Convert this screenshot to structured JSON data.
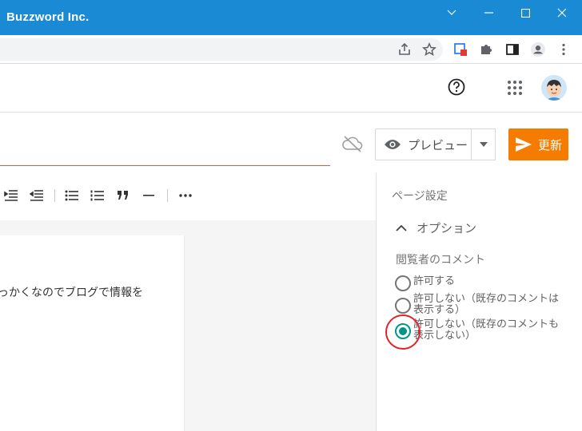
{
  "window": {
    "title": "Buzzword Inc."
  },
  "browser": {
    "icons": [
      "share-icon",
      "star-icon",
      "extension-badge-icon",
      "puzzle-icon",
      "sidepanel-icon",
      "profile-icon",
      "kebab-menu-icon"
    ]
  },
  "editor": {
    "preview_label": "プレビュー",
    "update_label": "更新",
    "body_text": "っかくなのでブログで情報を",
    "accent_color": "#f57c00",
    "title_underline_color": "#e8553f"
  },
  "sidebar": {
    "heading": "ページ設定",
    "section_label": "オプション",
    "comments_label": "閲覧者のコメント",
    "options": [
      {
        "label": "許可する",
        "selected": false
      },
      {
        "label": "許可しない（既存のコメントは表示する）",
        "selected": false
      },
      {
        "label": "許可しない（既存のコメントも表示しない）",
        "selected": true
      }
    ],
    "radio_color": "#009688",
    "highlight_color": "#e5202b"
  }
}
